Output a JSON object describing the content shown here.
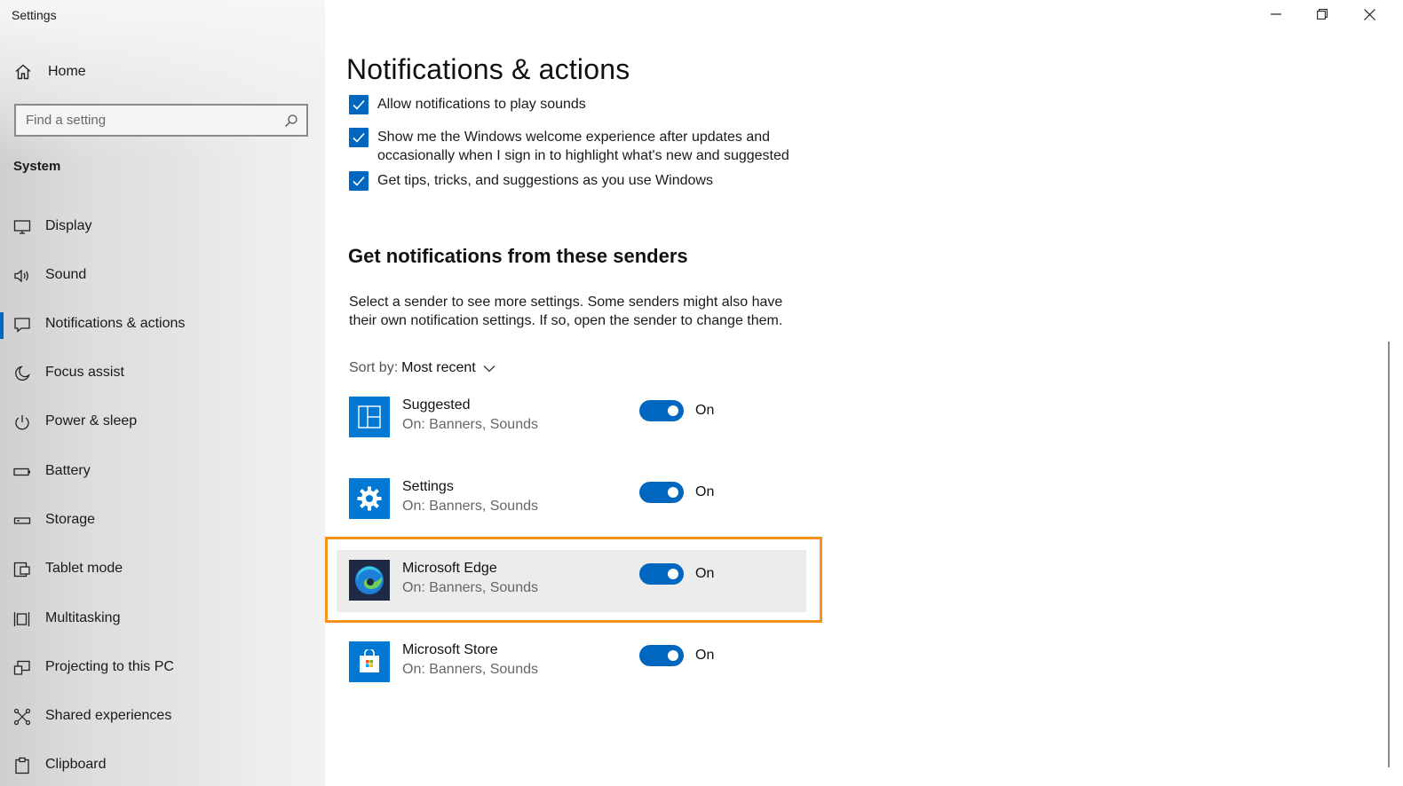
{
  "window": {
    "title": "Settings"
  },
  "sidebar": {
    "home_label": "Home",
    "search_placeholder": "Find a setting",
    "section": "System",
    "items": [
      {
        "label": "Display",
        "icon": "display-icon"
      },
      {
        "label": "Sound",
        "icon": "sound-icon"
      },
      {
        "label": "Notifications & actions",
        "icon": "notifications-icon",
        "active": true
      },
      {
        "label": "Focus assist",
        "icon": "moon-icon"
      },
      {
        "label": "Power & sleep",
        "icon": "power-icon"
      },
      {
        "label": "Battery",
        "icon": "battery-icon"
      },
      {
        "label": "Storage",
        "icon": "storage-icon"
      },
      {
        "label": "Tablet mode",
        "icon": "tablet-mode-icon"
      },
      {
        "label": "Multitasking",
        "icon": "multitasking-icon"
      },
      {
        "label": "Projecting to this PC",
        "icon": "projecting-icon"
      },
      {
        "label": "Shared experiences",
        "icon": "shared-experiences-icon"
      },
      {
        "label": "Clipboard",
        "icon": "clipboard-icon"
      }
    ]
  },
  "main": {
    "title": "Notifications & actions",
    "checkboxes": [
      {
        "label": "Allow notifications to play sounds",
        "checked": true
      },
      {
        "label": "Show me the Windows welcome experience after updates and occasionally when I sign in to highlight what's new and suggested",
        "checked": true
      },
      {
        "label": "Get tips, tricks, and suggestions as you use Windows",
        "checked": true
      }
    ],
    "senders_heading": "Get notifications from these senders",
    "senders_description": "Select a sender to see more settings. Some senders might also have their own notification settings. If so, open the sender to change them.",
    "sort_label": "Sort by:",
    "sort_value": "Most recent",
    "senders": [
      {
        "name": "Suggested",
        "status": "On: Banners, Sounds",
        "toggle": "On",
        "icon": "suggested-icon"
      },
      {
        "name": "Settings",
        "status": "On: Banners, Sounds",
        "toggle": "On",
        "icon": "gear-icon"
      },
      {
        "name": "Microsoft Edge",
        "status": "On: Banners, Sounds",
        "toggle": "On",
        "icon": "edge-icon",
        "highlighted": true
      },
      {
        "name": "Microsoft Store",
        "status": "On: Banners, Sounds",
        "toggle": "On",
        "icon": "store-icon"
      }
    ]
  },
  "colors": {
    "accent": "#0067c0",
    "focus": "#f7921e"
  }
}
